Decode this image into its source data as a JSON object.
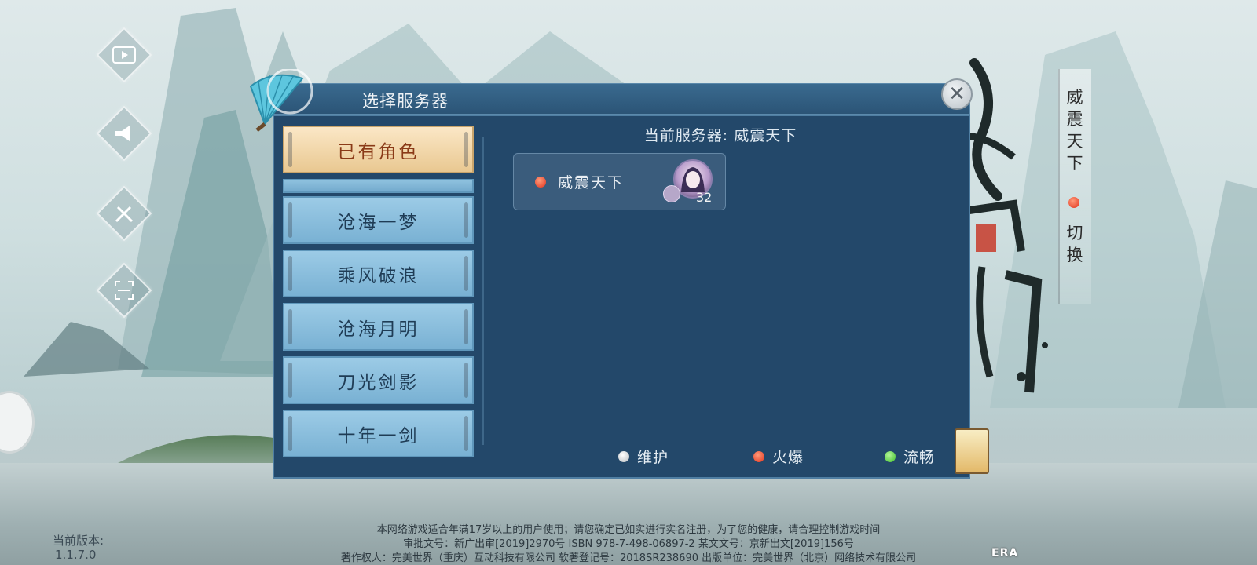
{
  "dialog": {
    "title": "选择服务器",
    "close_icon": "close-icon",
    "current_server_text": "当前服务器: 威震天下"
  },
  "tabs": [
    {
      "label": "已有角色",
      "active": true
    },
    {
      "label": "沧海一梦",
      "active": false
    },
    {
      "label": "乘风破浪",
      "active": false
    },
    {
      "label": "沧海月明",
      "active": false
    },
    {
      "label": "刀光剑影",
      "active": false
    },
    {
      "label": "十年一剑",
      "active": false
    }
  ],
  "server_card": {
    "name": "威震天下",
    "status": "火爆",
    "status_color": "#e2321b",
    "level": "32"
  },
  "legend": [
    {
      "label": "维护",
      "color": "#b7bcc0"
    },
    {
      "label": "火爆",
      "color": "#e2321b"
    },
    {
      "label": "流畅",
      "color": "#3fbf2a"
    }
  ],
  "side_buttons": [
    "video-icon",
    "announcement-icon",
    "repair-icon",
    "scan-icon"
  ],
  "right_banner": {
    "server_name": "威震天下",
    "switch_label": "切换"
  },
  "footer": {
    "line1": "本网络游戏适合年满17岁以上的用户使用；请您确定已如实进行实名注册，为了您的健康，请合理控制游戏时间",
    "line2": "审批文号：新广出审[2019]2970号   ISBN  978-7-498-06897-2   某文文号：京新出文[2019]156号",
    "line3": "著作权人：完美世界（重庆）互动科技有限公司   软著登记号：2018SR238690   出版单位：完美世界（北京）网络技术有限公司",
    "version_label": "当前版本:",
    "version": "1.1.7.0",
    "logo": "ERA"
  },
  "colors": {
    "dialog_bg": "#23486a",
    "tab_active_bg": "#f3d9a9",
    "tab_normal_bg": "#8bbfdf"
  }
}
